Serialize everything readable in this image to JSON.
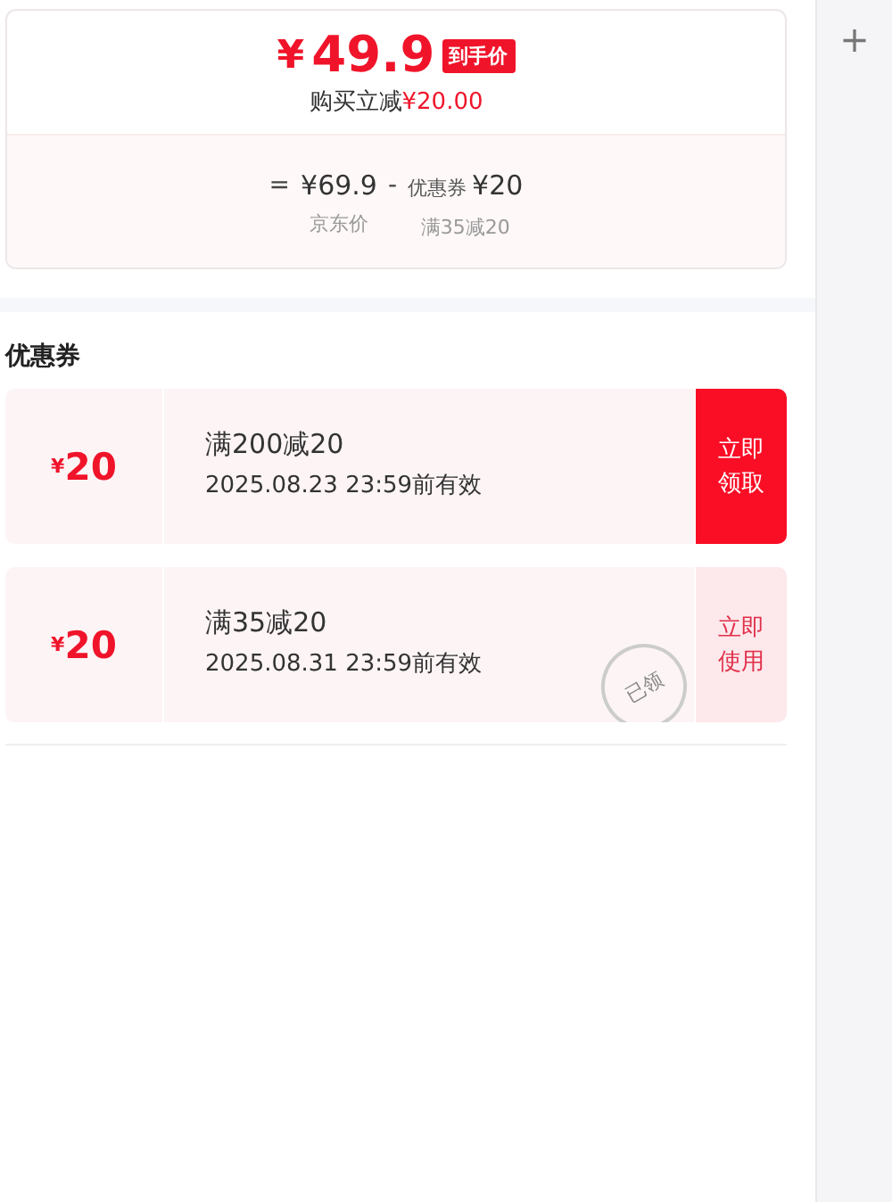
{
  "price_card": {
    "currency": "¥",
    "final_price": "49.9",
    "final_badge": "到手价",
    "saving_label": "购买立减",
    "saving_amount": "¥20.00",
    "breakdown": [
      {
        "kind": "operator",
        "text": "="
      },
      {
        "kind": "value",
        "amount": "¥69.9",
        "caption": "京东价"
      },
      {
        "kind": "operator",
        "text": "-"
      },
      {
        "kind": "value",
        "prefix": "优惠券",
        "amount": "¥20",
        "caption": "满35减20"
      }
    ]
  },
  "coupons_title": "优惠券",
  "coupons": [
    {
      "currency": "¥",
      "amount": "20",
      "rule": "满200减20",
      "validity": "2025.08.23 23:59前有效",
      "action": "立即领取",
      "claimed": false
    },
    {
      "currency": "¥",
      "amount": "20",
      "rule": "满35减20",
      "validity": "2025.08.31 23:59前有效",
      "action": "立即使用",
      "claimed": true,
      "stamp": "已领"
    }
  ],
  "side_panel": {
    "button": "+"
  }
}
